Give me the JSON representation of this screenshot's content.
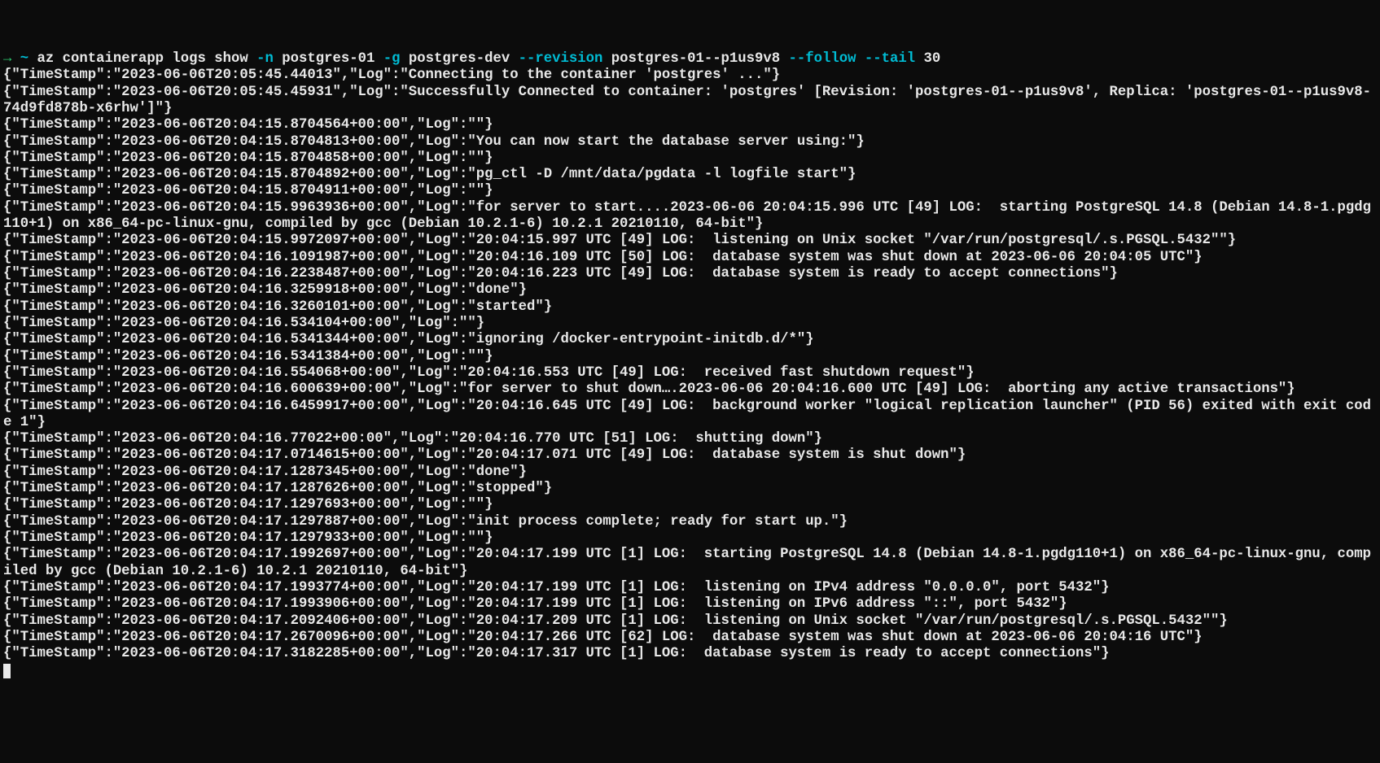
{
  "prompt": {
    "arrow": "→",
    "tilde": "~",
    "cmd_base": "az containerapp logs show ",
    "flag_n": "-n",
    "arg_n": " postgres-01 ",
    "flag_g": "-g",
    "arg_g": " postgres-dev ",
    "flag_rev": "--revision",
    "arg_rev": " postgres-01--p1us9v8 ",
    "flag_follow": "--follow",
    "sp1": " ",
    "flag_tail": "--tail",
    "arg_tail": " 30"
  },
  "logs": [
    "{\"TimeStamp\":\"2023-06-06T20:05:45.44013\",\"Log\":\"Connecting to the container 'postgres' ...\"}",
    "{\"TimeStamp\":\"2023-06-06T20:05:45.45931\",\"Log\":\"Successfully Connected to container: 'postgres' [Revision: 'postgres-01--p1us9v8', Replica: 'postgres-01--p1us9v8-74d9fd878b-x6rhw']\"}",
    "{\"TimeStamp\":\"2023-06-06T20:04:15.8704564+00:00\",\"Log\":\"\"}",
    "{\"TimeStamp\":\"2023-06-06T20:04:15.8704813+00:00\",\"Log\":\"You can now start the database server using:\"}",
    "{\"TimeStamp\":\"2023-06-06T20:04:15.8704858+00:00\",\"Log\":\"\"}",
    "{\"TimeStamp\":\"2023-06-06T20:04:15.8704892+00:00\",\"Log\":\"pg_ctl -D /mnt/data/pgdata -l logfile start\"}",
    "{\"TimeStamp\":\"2023-06-06T20:04:15.8704911+00:00\",\"Log\":\"\"}",
    "{\"TimeStamp\":\"2023-06-06T20:04:15.9963936+00:00\",\"Log\":\"for server to start....2023-06-06 20:04:15.996 UTC [49] LOG:  starting PostgreSQL 14.8 (Debian 14.8-1.pgdg110+1) on x86_64-pc-linux-gnu, compiled by gcc (Debian 10.2.1-6) 10.2.1 20210110, 64-bit\"}",
    "{\"TimeStamp\":\"2023-06-06T20:04:15.9972097+00:00\",\"Log\":\"20:04:15.997 UTC [49] LOG:  listening on Unix socket \"/var/run/postgresql/.s.PGSQL.5432\"\"}",
    "{\"TimeStamp\":\"2023-06-06T20:04:16.1091987+00:00\",\"Log\":\"20:04:16.109 UTC [50] LOG:  database system was shut down at 2023-06-06 20:04:05 UTC\"}",
    "{\"TimeStamp\":\"2023-06-06T20:04:16.2238487+00:00\",\"Log\":\"20:04:16.223 UTC [49] LOG:  database system is ready to accept connections\"}",
    "{\"TimeStamp\":\"2023-06-06T20:04:16.3259918+00:00\",\"Log\":\"done\"}",
    "{\"TimeStamp\":\"2023-06-06T20:04:16.3260101+00:00\",\"Log\":\"started\"}",
    "{\"TimeStamp\":\"2023-06-06T20:04:16.534104+00:00\",\"Log\":\"\"}",
    "{\"TimeStamp\":\"2023-06-06T20:04:16.5341344+00:00\",\"Log\":\"ignoring /docker-entrypoint-initdb.d/*\"}",
    "{\"TimeStamp\":\"2023-06-06T20:04:16.5341384+00:00\",\"Log\":\"\"}",
    "{\"TimeStamp\":\"2023-06-06T20:04:16.554068+00:00\",\"Log\":\"20:04:16.553 UTC [49] LOG:  received fast shutdown request\"}",
    "{\"TimeStamp\":\"2023-06-06T20:04:16.600639+00:00\",\"Log\":\"for server to shut down….2023-06-06 20:04:16.600 UTC [49] LOG:  aborting any active transactions\"}",
    "{\"TimeStamp\":\"2023-06-06T20:04:16.6459917+00:00\",\"Log\":\"20:04:16.645 UTC [49] LOG:  background worker \"logical replication launcher\" (PID 56) exited with exit code 1\"}",
    "{\"TimeStamp\":\"2023-06-06T20:04:16.77022+00:00\",\"Log\":\"20:04:16.770 UTC [51] LOG:  shutting down\"}",
    "{\"TimeStamp\":\"2023-06-06T20:04:17.0714615+00:00\",\"Log\":\"20:04:17.071 UTC [49] LOG:  database system is shut down\"}",
    "{\"TimeStamp\":\"2023-06-06T20:04:17.1287345+00:00\",\"Log\":\"done\"}",
    "{\"TimeStamp\":\"2023-06-06T20:04:17.1287626+00:00\",\"Log\":\"stopped\"}",
    "{\"TimeStamp\":\"2023-06-06T20:04:17.1297693+00:00\",\"Log\":\"\"}",
    "{\"TimeStamp\":\"2023-06-06T20:04:17.1297887+00:00\",\"Log\":\"init process complete; ready for start up.\"}",
    "{\"TimeStamp\":\"2023-06-06T20:04:17.1297933+00:00\",\"Log\":\"\"}",
    "{\"TimeStamp\":\"2023-06-06T20:04:17.1992697+00:00\",\"Log\":\"20:04:17.199 UTC [1] LOG:  starting PostgreSQL 14.8 (Debian 14.8-1.pgdg110+1) on x86_64-pc-linux-gnu, compiled by gcc (Debian 10.2.1-6) 10.2.1 20210110, 64-bit\"}",
    "{\"TimeStamp\":\"2023-06-06T20:04:17.1993774+00:00\",\"Log\":\"20:04:17.199 UTC [1] LOG:  listening on IPv4 address \"0.0.0.0\", port 5432\"}",
    "{\"TimeStamp\":\"2023-06-06T20:04:17.1993906+00:00\",\"Log\":\"20:04:17.199 UTC [1] LOG:  listening on IPv6 address \"::\", port 5432\"}",
    "{\"TimeStamp\":\"2023-06-06T20:04:17.2092406+00:00\",\"Log\":\"20:04:17.209 UTC [1] LOG:  listening on Unix socket \"/var/run/postgresql/.s.PGSQL.5432\"\"}",
    "{\"TimeStamp\":\"2023-06-06T20:04:17.2670096+00:00\",\"Log\":\"20:04:17.266 UTC [62] LOG:  database system was shut down at 2023-06-06 20:04:16 UTC\"}",
    "{\"TimeStamp\":\"2023-06-06T20:04:17.3182285+00:00\",\"Log\":\"20:04:17.317 UTC [1] LOG:  database system is ready to accept connections\"}"
  ]
}
